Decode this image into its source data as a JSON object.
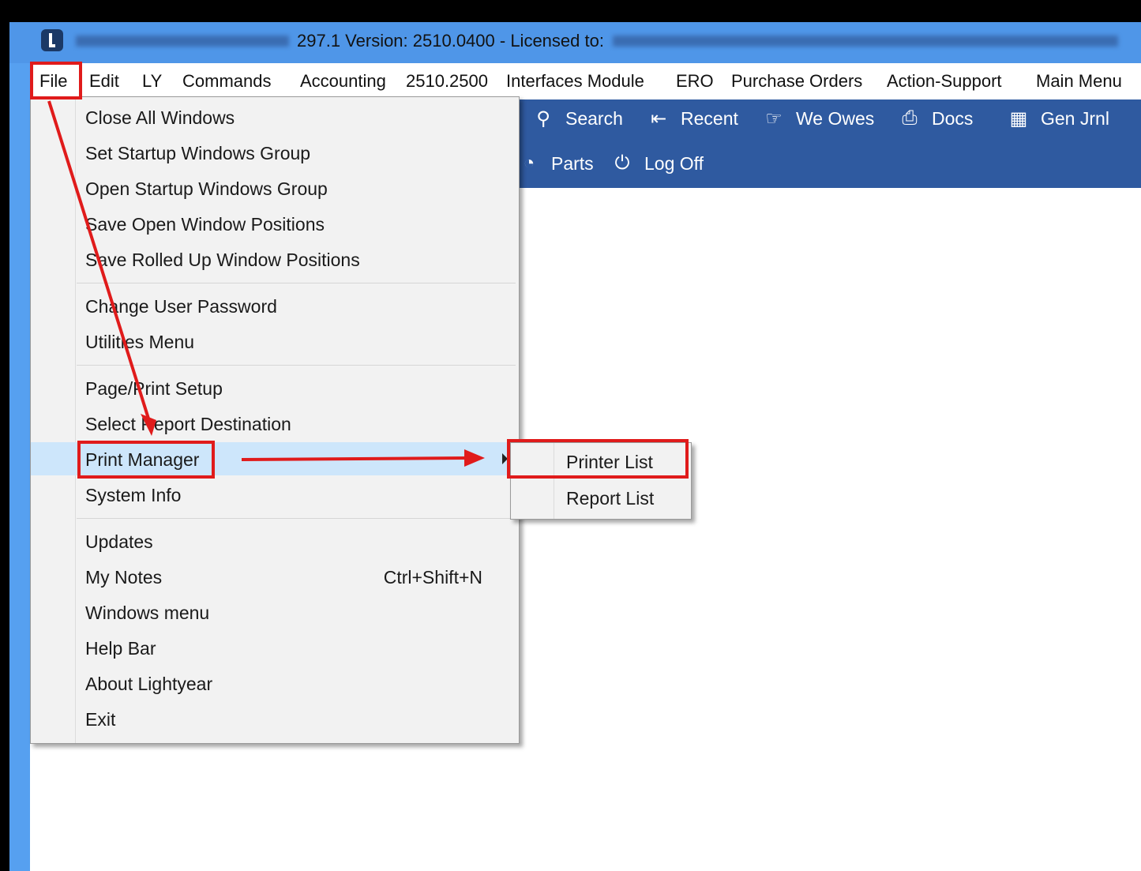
{
  "titlebar": {
    "title": "297.1 Version: 2510.0400 - Licensed to:"
  },
  "menubar": {
    "items": [
      "File",
      "Edit",
      "LY",
      "Commands",
      "Accounting",
      "2510.2500",
      "Interfaces Module",
      "ERO",
      "Purchase Orders",
      "Action-Support",
      "Main Menu"
    ]
  },
  "toolbar": {
    "row1": [
      {
        "icon": "search-icon",
        "label": "Search"
      },
      {
        "icon": "recent-icon",
        "label": "Recent"
      },
      {
        "icon": "we-owes-icon",
        "label": "We Owes"
      },
      {
        "icon": "pdf-docs-icon",
        "label": "Docs"
      },
      {
        "icon": "journal-icon",
        "label": "Gen Jrnl"
      }
    ],
    "row2": [
      {
        "icon": "parts-icon",
        "label": "Parts"
      },
      {
        "icon": "power-icon",
        "label": "Log Off"
      }
    ]
  },
  "file_menu": {
    "items": [
      {
        "label": "Close All Windows"
      },
      {
        "label": "Set Startup Windows Group"
      },
      {
        "label": "Open Startup Windows Group"
      },
      {
        "label": "Save Open Window Positions"
      },
      {
        "label": "Save Rolled Up Window Positions"
      },
      {
        "label": "Change User Password"
      },
      {
        "label": "Utilities Menu"
      },
      {
        "label": "Page/Print Setup"
      },
      {
        "label": "Select Report Destination"
      },
      {
        "label": "Print Manager"
      },
      {
        "label": "System Info"
      },
      {
        "label": "Updates"
      },
      {
        "label": "My Notes",
        "shortcut": "Ctrl+Shift+N"
      },
      {
        "label": "Windows menu"
      },
      {
        "label": "Help Bar"
      },
      {
        "label": "About Lightyear"
      },
      {
        "label": "Exit"
      }
    ]
  },
  "print_manager_submenu": {
    "items": [
      "Printer List",
      "Report List"
    ]
  },
  "colors": {
    "titlebar": "#4f96e8",
    "toolbar": "#2f5aa0",
    "highlight": "#cde6fb",
    "annotation": "#e01b1b"
  }
}
